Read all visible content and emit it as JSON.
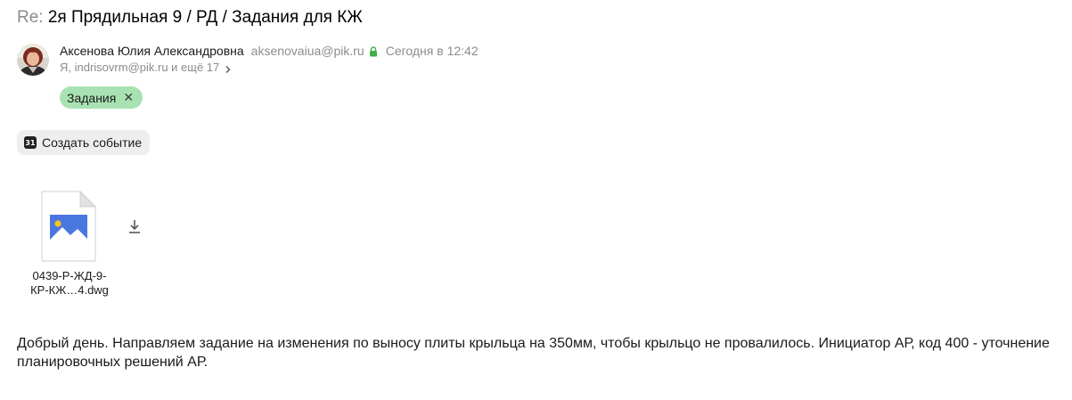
{
  "subject": {
    "prefix": "Re:",
    "title": "2я Прядильная 9 / РД / Задания для КЖ"
  },
  "sender": {
    "name": "Аксенова Юлия Александровна",
    "email": "aksenovaiua@pik.ru",
    "date": "Сегодня в 12:42"
  },
  "recipients": {
    "text": "Я, indrisovrm@pik.ru и ещё 17"
  },
  "tag": {
    "label": "Задания",
    "close": "✕"
  },
  "event_button": {
    "icon_text": "31",
    "label": "Создать событие"
  },
  "attachment": {
    "name_line1": "0439-Р-ЖД-9-",
    "name_line2": "КР-КЖ…4.dwg"
  },
  "body": {
    "text": "Добрый день. Направляем задание на изменения по выносу плиты крыльца на 350мм, чтобы крыльцо не провалилось. Инициатор АР, код 400 - уточнение планировочных решений АР."
  },
  "icons": {
    "avatar": "avatar-photo",
    "lock": "lock-icon",
    "recipients_more": "chevron-right-icon",
    "tag_remove": "close-icon",
    "calendar": "calendar-icon",
    "file": "image-file-icon",
    "download": "download-icon"
  },
  "colors": {
    "tag_bg": "#a8e2b2",
    "lock": "#3fb14a",
    "file_image": "#4a76e0",
    "file_sun": "#f5c518",
    "button_bg": "#eeeeee",
    "muted_text": "#8c8c8c"
  }
}
